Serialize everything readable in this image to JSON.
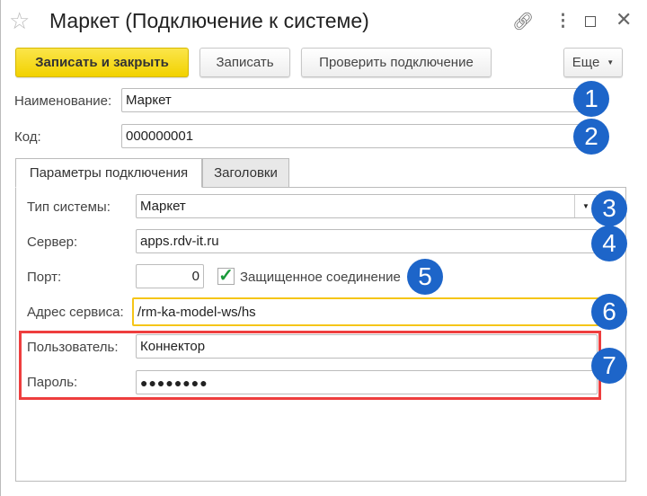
{
  "window": {
    "title": "Маркет (Подключение к системе)"
  },
  "toolbar": {
    "save_close": "Записать и закрыть",
    "save": "Записать",
    "check": "Проверить подключение",
    "more": "Еще"
  },
  "fields": {
    "name_label": "Наименование:",
    "name_value": "Маркет",
    "code_label": "Код:",
    "code_value": "000000001"
  },
  "tabs": [
    {
      "label": "Параметры подключения"
    },
    {
      "label": "Заголовки"
    }
  ],
  "connection": {
    "system_type_label": "Тип системы:",
    "system_type_value": "Маркет",
    "server_label": "Сервер:",
    "server_value": "apps.rdv-it.ru",
    "port_label": "Порт:",
    "port_value": "0",
    "secure_label": "Защищенное соединение",
    "secure_checked": true,
    "service_label": "Адрес сервиса:",
    "service_value": "/rm-ka-model-ws/hs",
    "user_label": "Пользователь:",
    "user_value": "Коннектор",
    "password_label": "Пароль:",
    "password_value": "●●●●●●●●"
  },
  "badges": [
    "1",
    "2",
    "3",
    "4",
    "5",
    "6",
    "7"
  ],
  "colors": {
    "badge": "#1d65c9",
    "highlight": "#ee3e3e",
    "focus": "#f5c518",
    "primary": "#f2d200"
  }
}
